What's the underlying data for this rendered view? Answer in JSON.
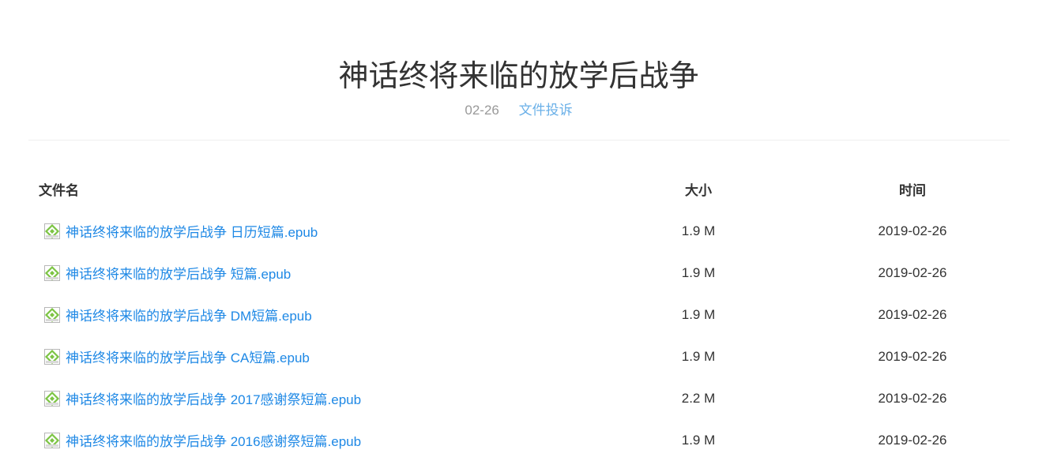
{
  "page": {
    "title": "神话终将来临的放学后战争",
    "date": "02-26",
    "report_link": "文件投诉"
  },
  "table": {
    "headers": {
      "name": "文件名",
      "size": "大小",
      "time": "时间"
    },
    "rows": [
      {
        "icon": "epub-file-icon",
        "name": "神话终将来临的放学后战争 日历短篇.epub",
        "size": "1.9 M",
        "time": "2019-02-26"
      },
      {
        "icon": "epub-file-icon",
        "name": "神话终将来临的放学后战争 短篇.epub",
        "size": "1.9 M",
        "time": "2019-02-26"
      },
      {
        "icon": "epub-file-icon",
        "name": "神话终将来临的放学后战争 DM短篇.epub",
        "size": "1.9 M",
        "time": "2019-02-26"
      },
      {
        "icon": "epub-file-icon",
        "name": "神话终将来临的放学后战争 CA短篇.epub",
        "size": "1.9 M",
        "time": "2019-02-26"
      },
      {
        "icon": "epub-file-icon",
        "name": "神话终将来临的放学后战争 2017感谢祭短篇.epub",
        "size": "2.2 M",
        "time": "2019-02-26"
      },
      {
        "icon": "epub-file-icon",
        "name": "神话终将来临的放学后战争 2016感谢祭短篇.epub",
        "size": "1.9 M",
        "time": "2019-02-26"
      }
    ]
  },
  "colors": {
    "link": "#1e88e5",
    "report_link": "#6ab0e8",
    "muted": "#999999",
    "text": "#333333",
    "icon_green": "#7cc443"
  }
}
